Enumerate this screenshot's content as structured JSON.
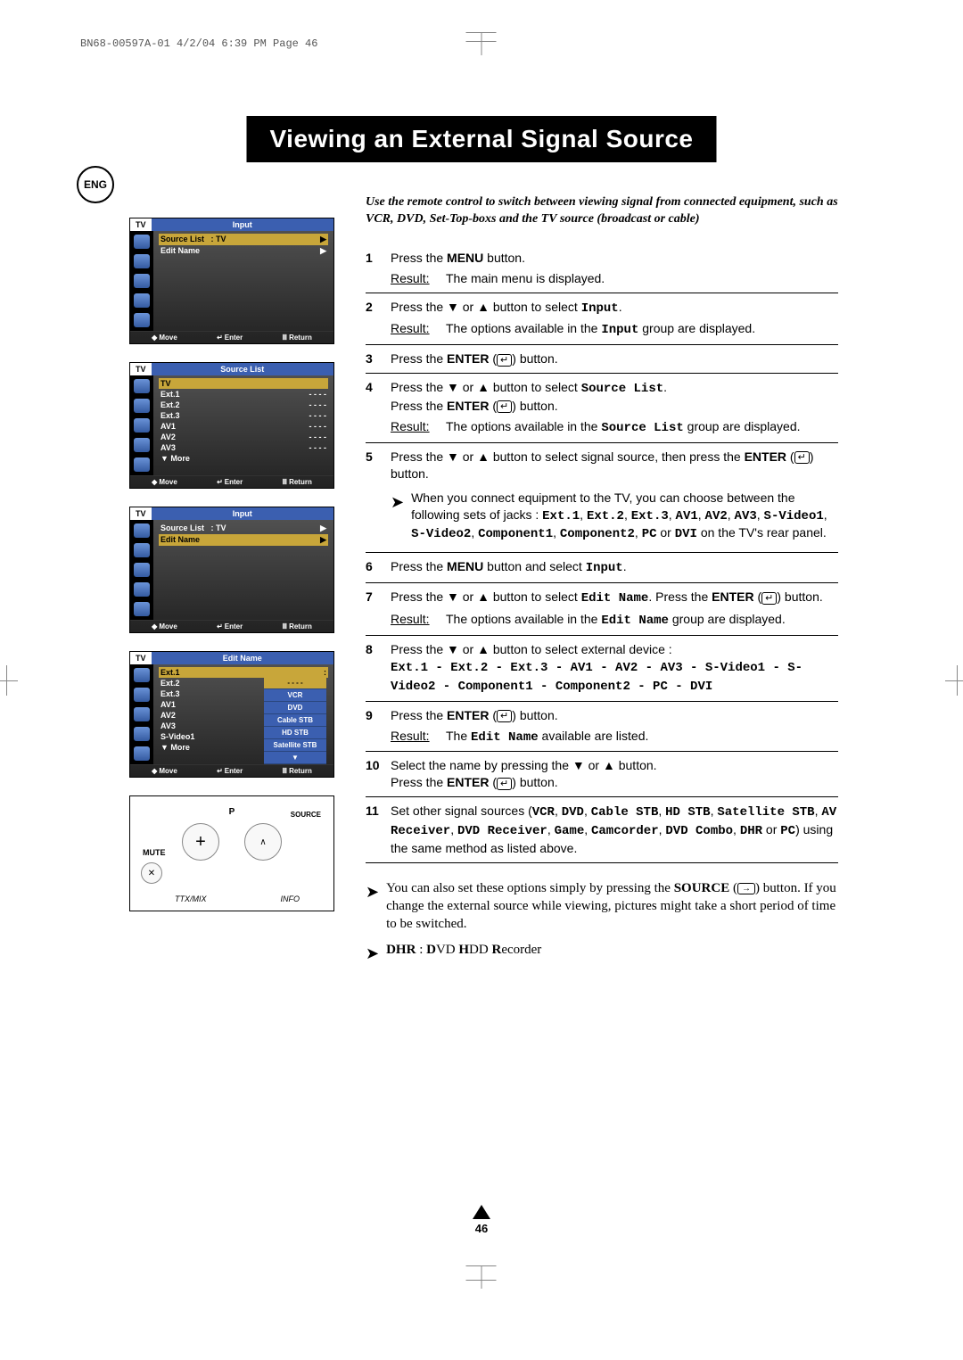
{
  "print_header": "BN68-00597A-01  4/2/04  6:39 PM  Page 46",
  "page_title": "Viewing an External Signal Source",
  "lang_badge": "ENG",
  "page_number": "46",
  "intro": "Use the remote control to switch between viewing signal from connected equipment, such as VCR, DVD, Set-Top-boxs and the TV source (broadcast or cable)",
  "osd1": {
    "tv": "TV",
    "title": "Input",
    "rows": [
      {
        "label": "Source List",
        "val": ": TV",
        "arrow": "▶"
      },
      {
        "label": "Edit Name",
        "val": "",
        "arrow": "▶"
      }
    ],
    "foot": {
      "move": "Move",
      "enter": "Enter",
      "return": "Return"
    }
  },
  "osd2": {
    "tv": "TV",
    "title": "Source List",
    "rows": [
      {
        "label": "TV",
        "val": ""
      },
      {
        "label": "Ext.1",
        "val": "- - - -"
      },
      {
        "label": "Ext.2",
        "val": "- - - -"
      },
      {
        "label": "Ext.3",
        "val": "- - - -"
      },
      {
        "label": "AV1",
        "val": "- - - -"
      },
      {
        "label": "AV2",
        "val": "- - - -"
      },
      {
        "label": "AV3",
        "val": "- - - -"
      },
      {
        "label": "▼ More",
        "val": ""
      }
    ],
    "foot": {
      "move": "Move",
      "enter": "Enter",
      "return": "Return"
    }
  },
  "osd3": {
    "tv": "TV",
    "title": "Input",
    "rows": [
      {
        "label": "Source List",
        "val": ": TV",
        "arrow": "▶"
      },
      {
        "label": "Edit Name",
        "val": "",
        "arrow": "▶"
      }
    ],
    "foot": {
      "move": "Move",
      "enter": "Enter",
      "return": "Return"
    }
  },
  "osd4": {
    "tv": "TV",
    "title": "Edit Name",
    "rows": [
      {
        "label": "Ext.1",
        "val": ":"
      },
      {
        "label": "Ext.2",
        "val": ":"
      },
      {
        "label": "Ext.3",
        "val": ":"
      },
      {
        "label": "AV1",
        "val": ":"
      },
      {
        "label": "AV2",
        "val": ":"
      },
      {
        "label": "AV3",
        "val": ":"
      },
      {
        "label": "S-Video1",
        "val": ":"
      },
      {
        "label": "▼ More",
        "val": ""
      }
    ],
    "foot": {
      "move": "Move",
      "enter": "Enter",
      "return": "Return"
    },
    "popup": [
      "- - - -",
      "VCR",
      "DVD",
      "Cable STB",
      "HD STB",
      "Satellite STB",
      "▼"
    ]
  },
  "remote": {
    "p": "P",
    "source": "SOURCE",
    "mute": "MUTE",
    "ttx": "TTX/MIX",
    "info": "INFO"
  },
  "steps": [
    {
      "n": "1",
      "l1": "Press the <b>MENU</b> button.",
      "result": "The main menu is displayed."
    },
    {
      "n": "2",
      "l1": "Press the ▼ or ▲ button to select <span class='mono'>Input</span>.",
      "result": "The options available in the <span class='mono'>Input</span> group are displayed."
    },
    {
      "n": "3",
      "l1": "Press the <b>ENTER</b> (<span class='enter-glyph'>↵</span>) button."
    },
    {
      "n": "4",
      "l1": "Press the ▼ or ▲ button to select <span class='mono'>Source List</span>.<br>Press the <b>ENTER</b> (<span class='enter-glyph'>↵</span>) button.",
      "result": "The options available in the <span class='mono'>Source List</span> group are displayed."
    },
    {
      "n": "5",
      "l1": "Press the ▼ or ▲ button to select signal source, then press the <b>ENTER</b> (<span class='enter-glyph'>↵</span>) button.",
      "note": "When you connect equipment to the TV, you can choose between the following sets of jacks : <span class='mono'>Ext.1</span>, <span class='mono'>Ext.2</span>, <span class='mono'>Ext.3</span>, <span class='mono'>AV1</span>, <span class='mono'>AV2</span>, <span class='mono'>AV3</span>, <span class='mono'>S-Video1</span>, <span class='mono'>S-Video2</span>, <span class='mono'>Component1</span>, <span class='mono'>Component2</span>, <span class='mono'>PC</span> or <span class='mono'>DVI</span> on the TV's rear panel."
    },
    {
      "n": "6",
      "l1": "Press the <b>MENU</b> button and select <span class='mono'>Input</span>."
    },
    {
      "n": "7",
      "l1": "Press the ▼ or ▲ button to select <span class='mono'>Edit Name</span>. Press the <b>ENTER</b> (<span class='enter-glyph'>↵</span>) button.",
      "result": "The options available in the <span class='mono'>Edit Name</span> group are displayed."
    },
    {
      "n": "8",
      "l1": "Press the ▼ or ▲ button to select external device :<br><span class='mono'>Ext.1 - Ext.2 - Ext.3 - AV1 - AV2 - AV3 - S-Video1 - S-Video2 - Component1 - Component2 - PC - DVI</span>"
    },
    {
      "n": "9",
      "l1": "Press the <b>ENTER</b> (<span class='enter-glyph'>↵</span>) button.",
      "result": "The <span class='mono'>Edit Name</span> available are listed."
    },
    {
      "n": "10",
      "l1": "Select the name by pressing the ▼ or ▲ button.<br>Press the <b>ENTER</b> (<span class='enter-glyph'>↵</span>) button."
    },
    {
      "n": "11",
      "l1": "Set other signal sources (<span class='mono'>VCR</span>, <span class='mono'>DVD</span>, <span class='mono'>Cable STB</span>, <span class='mono'>HD STB</span>, <span class='mono'>Satellite STB</span>, <span class='mono'>AV Receiver</span>, <span class='mono'>DVD Receiver</span>, <span class='mono'>Game</span>, <span class='mono'>Camcorder</span>, <span class='mono'>DVD Combo</span>, <span class='mono'>DHR</span> or <span class='mono'>PC</span>) using the same method as listed above."
    }
  ],
  "end_notes": [
    "You can also set these options simply by pressing the <b>SOURCE</b> (<span class='source-glyph'>→</span>) button. If you change the external source while viewing, pictures might take a short period of time to be switched.",
    "<b>DHR</b> : <b>D</b>VD <b>H</b>DD <b>R</b>ecorder"
  ],
  "result_label": "Result:",
  "arrows": {
    "updown": "◆",
    "enter_sym": "↵",
    "return_sym": "Ⅲ"
  }
}
